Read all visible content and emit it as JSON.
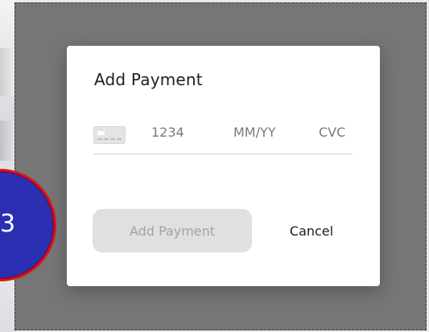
{
  "modal": {
    "title": "Add Payment",
    "card_field": {
      "icon": "credit-card-icon",
      "number_placeholder": "1234",
      "expiry_placeholder": "MM/YY",
      "cvc_placeholder": "CVC"
    },
    "add_button_label": "Add Payment",
    "cancel_button_label": "Cancel"
  },
  "badge": {
    "text": "3"
  },
  "colors": {
    "overlay": "#767676",
    "badge_fill": "#2b2fb2",
    "badge_border": "#e0101a",
    "button_disabled_bg": "#e0e0e0",
    "button_disabled_text": "#a3a3a3"
  }
}
